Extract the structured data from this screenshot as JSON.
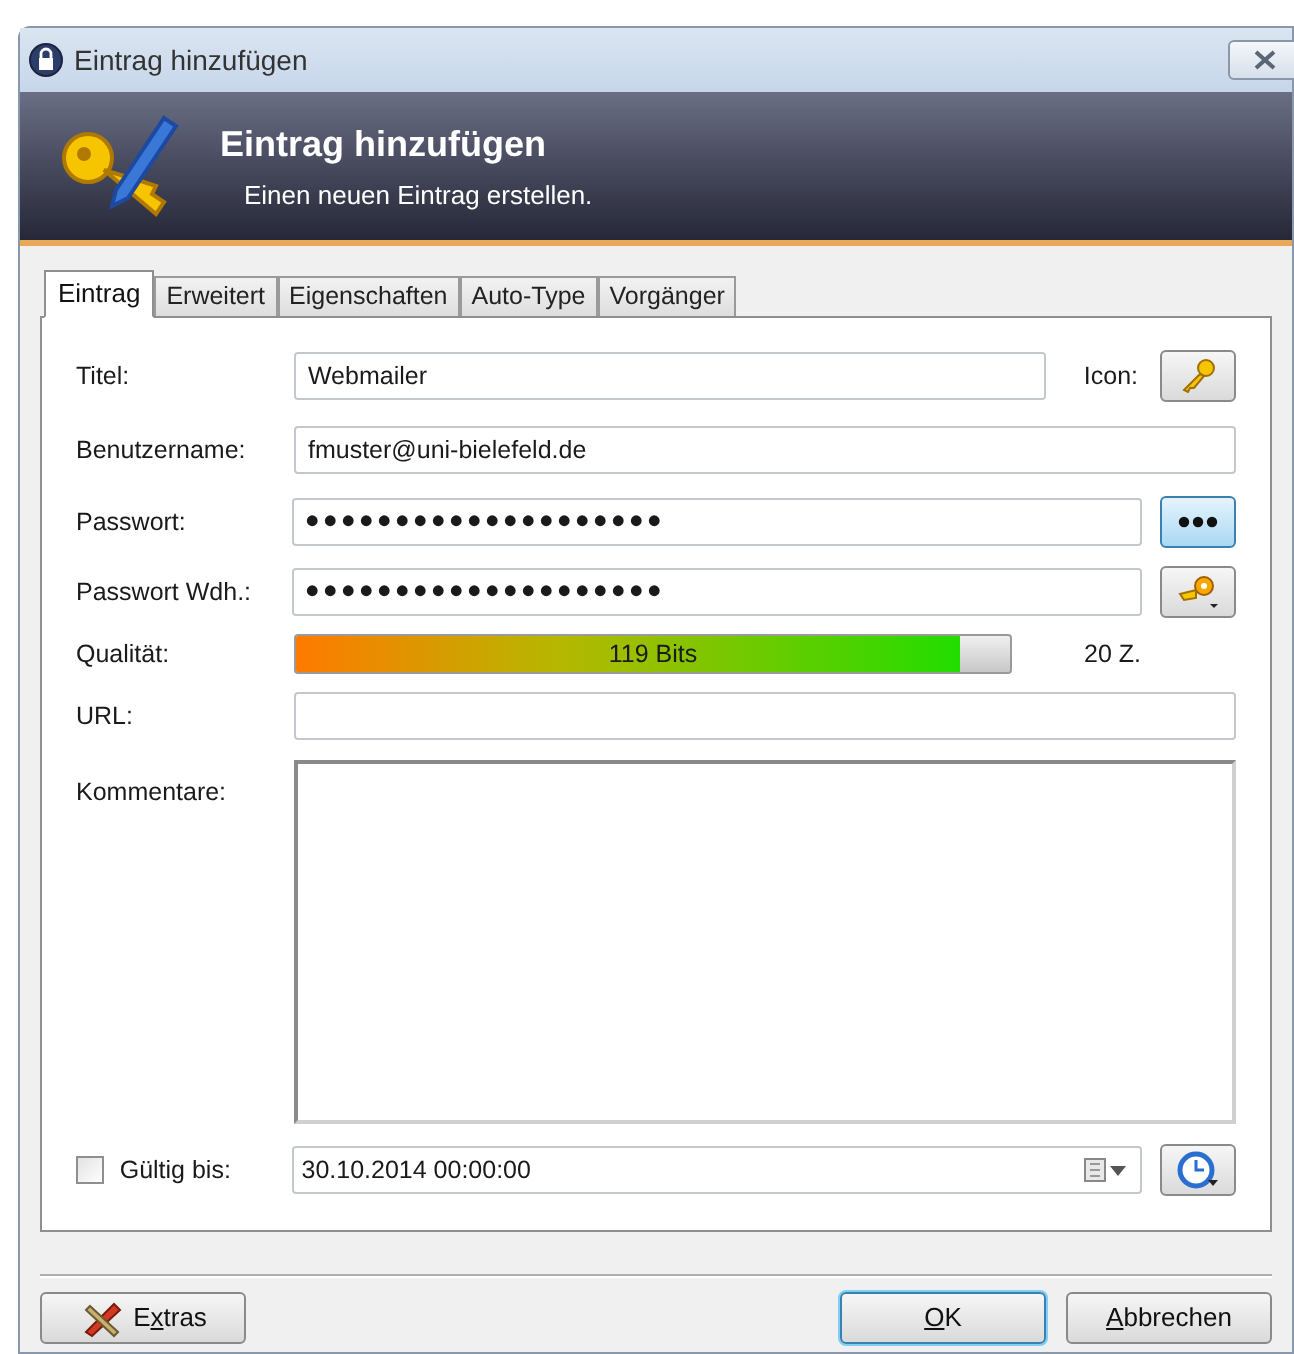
{
  "window": {
    "title": "Eintrag hinzufügen"
  },
  "banner": {
    "title": "Eintrag hinzufügen",
    "subtitle": "Einen neuen Eintrag erstellen."
  },
  "tabs": [
    {
      "label": "Eintrag",
      "selected": true
    },
    {
      "label": "Erweitert",
      "selected": false
    },
    {
      "label": "Eigenschaften",
      "selected": false
    },
    {
      "label": "Auto-Type",
      "selected": false
    },
    {
      "label": "Vorgänger",
      "selected": false
    }
  ],
  "form": {
    "title": {
      "label": "Titel:",
      "value": "Webmailer",
      "icon_label": "Icon:"
    },
    "username": {
      "label": "Benutzername:",
      "value": "fmuster@uni-bielefeld.de"
    },
    "password": {
      "label": "Passwort:",
      "value": "••••••••••••••••••••",
      "hidden": true
    },
    "repeat": {
      "label": "Passwort Wdh.:",
      "value": "••••••••••••••••••••"
    },
    "quality": {
      "label": "Qualität:",
      "level": 0.93,
      "reading": "119 Bits",
      "length": "20 Z."
    },
    "url": {
      "label": "URL:"
    },
    "notes": {
      "label": "Kommentare:"
    },
    "expires": {
      "label": "Gültig bis:",
      "checked": false,
      "value": "30.10.2014 00:00:00"
    }
  },
  "buttons": [
    {
      "before": "E",
      "mnemonic": "x",
      "after": "tras",
      "kind": "tools"
    },
    {
      "mnemonic": "O",
      "after": "K",
      "kind": "default"
    },
    {
      "mnemonic": "A",
      "after": "bbrechen",
      "kind": "plain"
    }
  ]
}
